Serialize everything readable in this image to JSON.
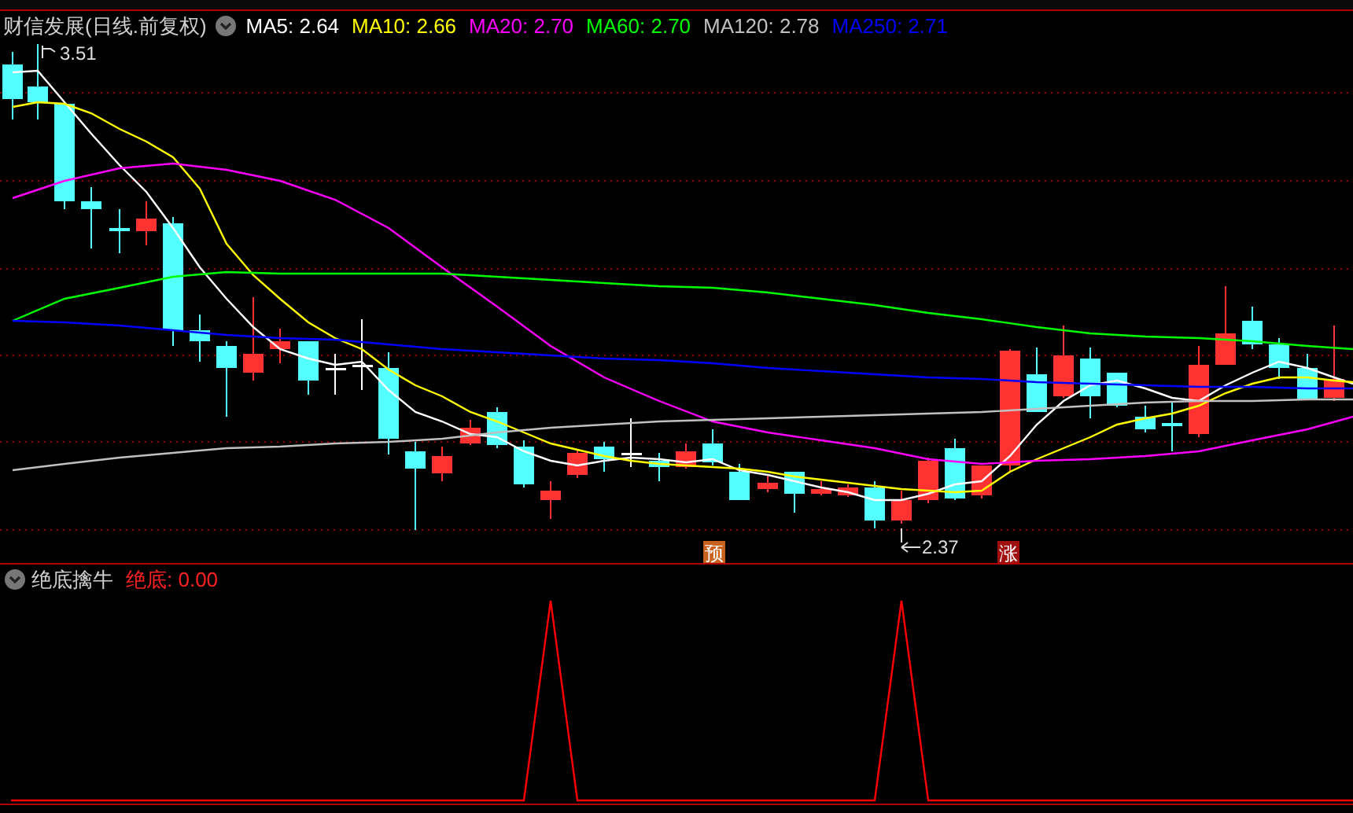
{
  "header": {
    "title": "财信发展(日线.前复权)",
    "moving_averages": [
      {
        "label": "MA5: 2.64",
        "color": "#ffffff"
      },
      {
        "label": "MA10: 2.66",
        "color": "#ffff00"
      },
      {
        "label": "MA20: 2.70",
        "color": "#ff00ff"
      },
      {
        "label": "MA60: 2.70",
        "color": "#00ff00"
      },
      {
        "label": "MA120: 2.78",
        "color": "#c0c0c0"
      },
      {
        "label": "MA250: 2.71",
        "color": "#0000ff"
      }
    ]
  },
  "chart": {
    "high_label": "3.51",
    "low_label": "2.37",
    "signals": [
      {
        "text": "预",
        "kind": "forecast"
      },
      {
        "text": "涨",
        "kind": "rise"
      }
    ]
  },
  "indicator": {
    "name": "绝底擒牛",
    "value_label": "绝底: 0.00"
  }
}
